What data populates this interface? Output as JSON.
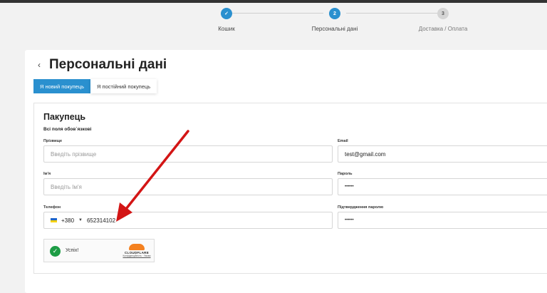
{
  "stepper": {
    "steps": [
      {
        "num": "✓",
        "label": "Кошик",
        "state": "done"
      },
      {
        "num": "2",
        "label": "Персональні дані",
        "state": "active"
      },
      {
        "num": "3",
        "label": "Доставка / Оплата",
        "state": "pending"
      }
    ]
  },
  "page": {
    "back": "‹",
    "title": "Персональні дані",
    "tabs": [
      "Я новий покупець",
      "Я постійний покупець"
    ]
  },
  "buyer": {
    "title": "Пакупець",
    "note": "Всі поля обов`язкові",
    "surname": {
      "label": "Прізвище",
      "placeholder": "Введіть прізвище"
    },
    "name": {
      "label": "Ім'я",
      "placeholder": "Введіть Ім'я"
    },
    "phone": {
      "label": "Телефон",
      "code": "+380",
      "value": "652314102"
    },
    "email": {
      "label": "Email",
      "value": "test@gmail.com"
    },
    "password": {
      "label": "Пароль",
      "value": "••••••"
    },
    "password_confirm": {
      "label": "Підтвердження паролю",
      "value": "••••••"
    }
  },
  "captcha": {
    "status": "Успіх!",
    "brand": "CLOUDFLARE",
    "links": "Конфіденційність · Умови"
  },
  "colors": {
    "accent": "#2a90cf",
    "arrow": "#d31515",
    "success": "#1d9c45"
  }
}
